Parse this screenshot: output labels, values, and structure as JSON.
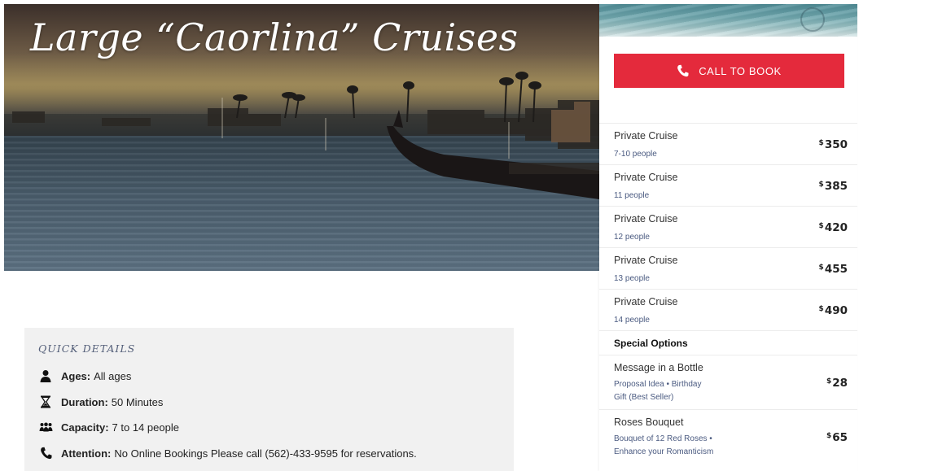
{
  "hero": {
    "title": "Large “Caorlina” Cruises"
  },
  "booking": {
    "call_label": "CALL TO BOOK",
    "button_color": "#e42a3c"
  },
  "pricing": {
    "rows": [
      {
        "name": "Private Cruise",
        "sub": "7-10 people",
        "currency": "$",
        "price": "350"
      },
      {
        "name": "Private Cruise",
        "sub": "11 people",
        "currency": "$",
        "price": "385"
      },
      {
        "name": "Private Cruise",
        "sub": "12 people",
        "currency": "$",
        "price": "420"
      },
      {
        "name": "Private Cruise",
        "sub": "13 people",
        "currency": "$",
        "price": "455"
      },
      {
        "name": "Private Cruise",
        "sub": "14 people",
        "currency": "$",
        "price": "490"
      }
    ],
    "special_heading": "Special Options",
    "options": [
      {
        "name": "Message in a Bottle",
        "sub1": "Proposal Idea • Birthday",
        "sub2": "Gift (Best Seller)",
        "currency": "$",
        "price": "28"
      },
      {
        "name": "Roses Bouquet",
        "sub1": "Bouquet of 12 Red Roses •",
        "sub2": "Enhance your Romanticism",
        "currency": "$",
        "price": "65"
      }
    ]
  },
  "quick_details": {
    "title": "QUICK DETAILS",
    "items": [
      {
        "icon": "person-icon",
        "label": "Ages:",
        "value": "All ages"
      },
      {
        "icon": "hourglass-icon",
        "label": "Duration:",
        "value": "50 Minutes"
      },
      {
        "icon": "group-icon",
        "label": "Capacity:",
        "value": "7 to 14 people"
      },
      {
        "icon": "phone-icon",
        "label": "Attention:",
        "value": "No Online Bookings Please call (562)-433-9595 for reservations."
      }
    ]
  }
}
